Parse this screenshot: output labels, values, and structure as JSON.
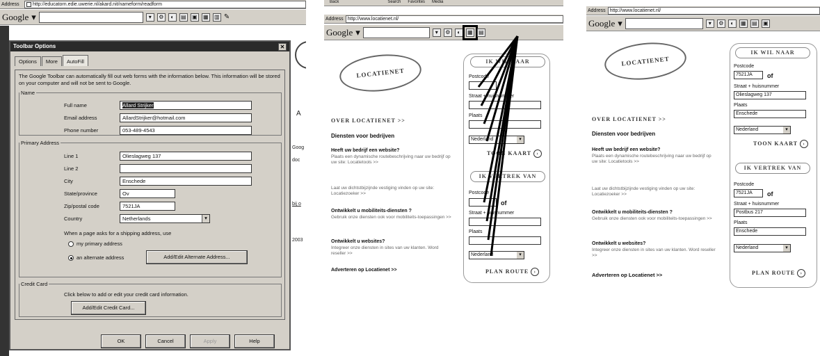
{
  "screen1": {
    "address_url": "http://educatorn.edie.uwerie.nl/akard.nit/nameform/readform",
    "google_label": "Google",
    "side_text": [
      "A",
      "Goog",
      "doc",
      "bij o",
      "2003"
    ],
    "dialog": {
      "title": "Toolbar Options",
      "tabs": [
        "Options",
        "More",
        "AutoFill"
      ],
      "intro": "The Google Toolbar can automatically fill out web forms with the information below. This information will be stored on your computer and will not be sent to Google.",
      "name_legend": "Name",
      "full_name_label": "Full name",
      "full_name": "Allard Strijker",
      "email_label": "Email address",
      "email": "AllardStrijker@hotmail.com",
      "phone_label": "Phone number",
      "phone": "053-489-4543",
      "address_legend": "Primary Address",
      "line1_label": "Line 1",
      "line1": "Olieslagweg 137",
      "line2_label": "Line 2",
      "line2": "",
      "city_label": "City",
      "city": "Enschede",
      "state_label": "State/province",
      "state": "Ov",
      "zip_label": "Zip/postal code",
      "zip": "7521JA",
      "country_label": "Country",
      "country": "Netherlands",
      "shipping_text": "When a page asks for a shipping address, use",
      "opt_primary": "my primary address",
      "opt_alternate": "an alternate address",
      "alt_button": "Add/Edit Alternate Address...",
      "card_legend": "Credit Card",
      "card_text": "Click below to add or edit your credit card information.",
      "card_button": "Add/Edit Credit Card...",
      "ok": "OK",
      "cancel": "Cancel",
      "apply": "Apply",
      "help": "Help"
    }
  },
  "screen2": {
    "menu_items": [
      "Back",
      "Search",
      "Favorites",
      "Media"
    ],
    "address_label": "Address",
    "address_url": "http://www.locatienet.nl/",
    "google_label": "Google",
    "logo": "LOCATIENET",
    "over": "OVER LOCATIENET >>",
    "services_title": "Diensten voor bedrijven",
    "blocks": [
      {
        "title": "Heeft uw bedrijf een website?",
        "body": "Plaats een dynamische routebeschrijving naar uw bedrijf op uw site: Locatietools >>"
      },
      {
        "title": "",
        "body": "Laat uw dichtstbijzijnde vestiging vinden op uw site: Locatiezoeker >>"
      },
      {
        "title": "Ontwikkelt u mobiliteits-diensten ?",
        "body": "Gebruik onze diensten ook voor mobiliteits-toepassingen >>"
      },
      {
        "title": "Ontwikkelt u websites?",
        "body": "Integreer onze diensten in sites van uw klanten. Word reseller >>"
      }
    ],
    "adverteren": "Adverteren op Locatienet >>",
    "wil_naar": "IK WIL NAAR",
    "vertrek": "IK VERTREK VAN",
    "postcode_label": "Postcode",
    "of": "of",
    "straat_label": "Straat + huisnummer",
    "plaats_label": "Plaats",
    "country_select": "Nederland",
    "toon_kaart": "TOON KAART",
    "plan_route": "PLAN ROUTE"
  },
  "screen3": {
    "address_label": "Address",
    "address_url": "http://www.locatienet.nl/",
    "google_label": "Google",
    "logo": "LOCATIENET",
    "over": "OVER LOCATIENET >>",
    "services_title": "Diensten voor bedrijven",
    "blocks": [
      {
        "title": "Heeft uw bedrijf een website?",
        "body": "Plaats een dynamische routebeschrijving naar uw bedrijf op uw site: Locatietools >>"
      },
      {
        "title": "",
        "body": "Laat uw dichtstbijzijnde vestiging vinden op uw site: Locatiezoeker >>"
      },
      {
        "title": "Ontwikkelt u mobiliteits-diensten ?",
        "body": "Gebruik onze diensten ook voor mobiliteits-toepassingen >>"
      },
      {
        "title": "Ontwikkelt u websites?",
        "body": "Integreer onze diensten in sites van uw klanten. Word reseller >>"
      }
    ],
    "adverteren": "Adverteren op Locatienet >>",
    "wil_naar": "IK WIL NAAR",
    "vertrek": "IK VERTREK VAN",
    "postcode_label": "Postcode",
    "of": "of",
    "straat_label": "Straat + huisnummer",
    "plaats_label": "Plaats",
    "naar": {
      "postcode": "7521JA",
      "straat": "Olieslagweg 137",
      "plaats": "Enschede",
      "country": "Nederland"
    },
    "van": {
      "postcode": "7521JA",
      "straat": "Postbus 217",
      "plaats": "Enschede",
      "country": "Nederland"
    },
    "toon_kaart": "TOON KAART",
    "plan_route": "PLAN ROUTE"
  }
}
